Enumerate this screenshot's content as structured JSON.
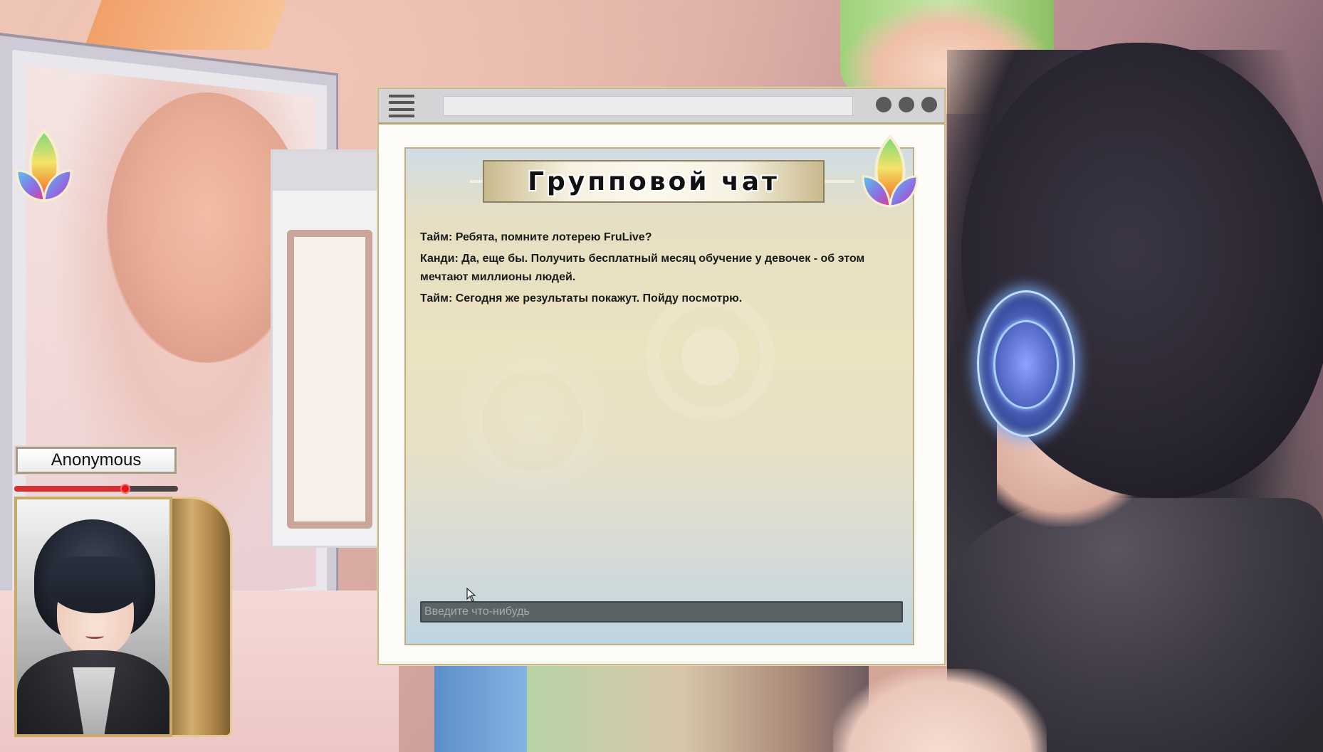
{
  "chat": {
    "title": "Групповой чат",
    "messages": [
      {
        "text": "Тайм: Ребята, помните лотерею FruLive?"
      },
      {
        "text": "Канди: Да, еще бы. Получить бесплатный месяц обучение у девочек - об этом мечтают миллионы людей."
      },
      {
        "text": "Тайм: Сегодня же результаты покажут. Пойду посмотрю."
      }
    ],
    "input": {
      "placeholder": "Введите что-нибудь",
      "value": ""
    }
  },
  "player": {
    "name": "Anonymous",
    "health_fraction": 0.68
  },
  "colors": {
    "accent_gold": "#c4ae7f",
    "input_bg": "#5b6367",
    "health": "#d62f2f"
  },
  "icons": [
    "hamburger-menu-icon",
    "window-button-icon",
    "rainbow-leaf-icon",
    "mouse-cursor-icon"
  ]
}
